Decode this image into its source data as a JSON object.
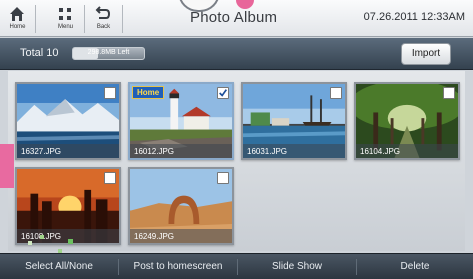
{
  "header": {
    "title": "Photo Album",
    "datetime": "07.26.2011 12:33AM",
    "nav": [
      {
        "label": "Home",
        "icon": "home-icon"
      },
      {
        "label": "Menu",
        "icon": "grid-menu-icon"
      },
      {
        "label": "Back",
        "icon": "back-arrow-icon"
      }
    ]
  },
  "toolbar": {
    "total_label": "Total 10",
    "storage_text": "298.8MB Left",
    "storage_used_fraction": 0.35,
    "import_label": "Import"
  },
  "photos": [
    {
      "name": "16327.JPG",
      "checked": false,
      "home": false
    },
    {
      "name": "16012.JPG",
      "checked": true,
      "home": true,
      "home_label": "Home"
    },
    {
      "name": "16031.JPG",
      "checked": false,
      "home": false
    },
    {
      "name": "16104.JPG",
      "checked": false,
      "home": false
    },
    {
      "name": "16108.JPG",
      "checked": false,
      "home": false
    },
    {
      "name": "16249.JPG",
      "checked": false,
      "home": false
    }
  ],
  "actions": {
    "select_all": "Select All/None",
    "post_home": "Post to homescreen",
    "slideshow": "Slide Show",
    "delete": "Delete"
  },
  "colors": {
    "accent": "#1f5fb8",
    "toolbar_dark": "#34424f",
    "pink": "#e86aa0"
  }
}
